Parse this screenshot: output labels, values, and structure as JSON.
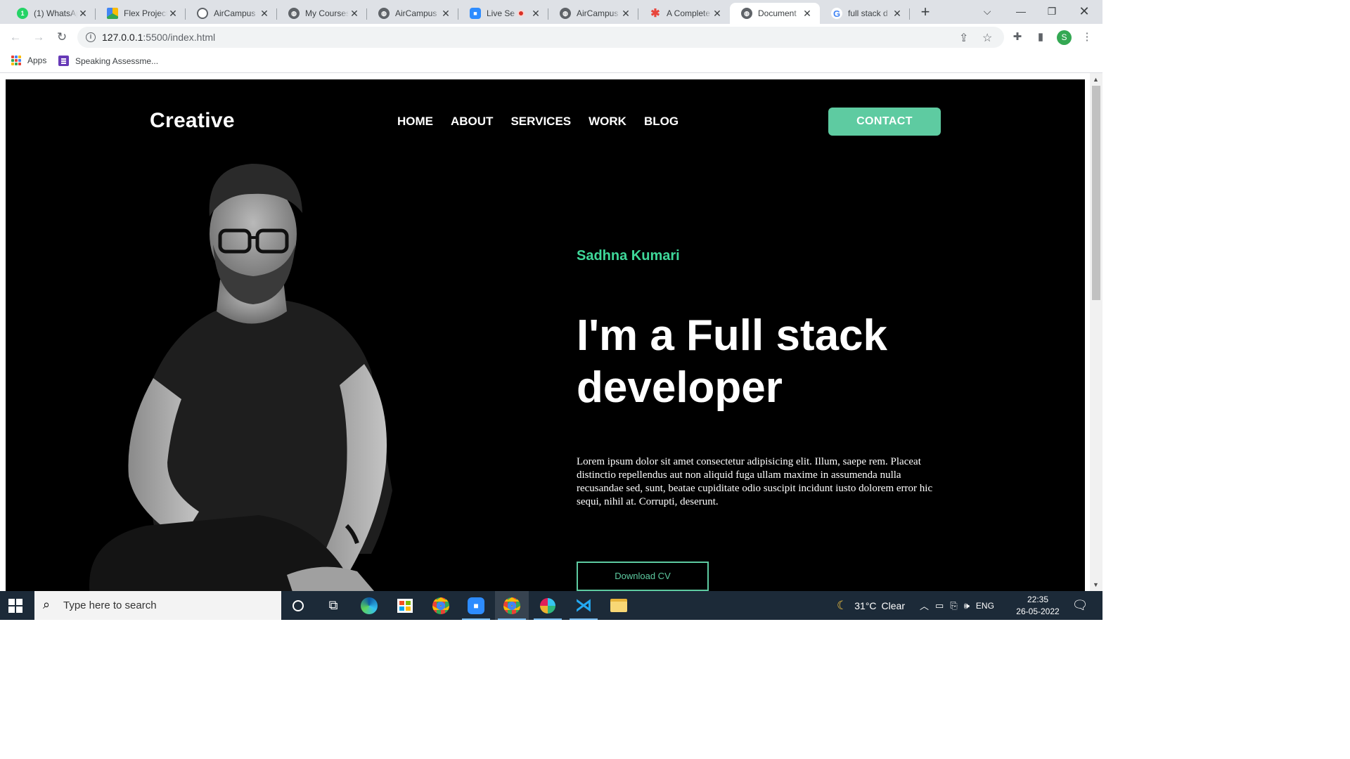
{
  "browser": {
    "tabs": [
      {
        "title": "(1) WhatsApp",
        "icon": "whatsapp-icon",
        "color": "#25d366",
        "badge": "1"
      },
      {
        "title": "Flex Project",
        "icon": "google-drive-icon",
        "color": "#fbbc04"
      },
      {
        "title": "AirCampus",
        "icon": "aircampus-icon",
        "color": "#5f6368"
      },
      {
        "title": "My Courses",
        "icon": "globe-icon",
        "color": "#5f6368"
      },
      {
        "title": "AirCampus",
        "icon": "globe-icon",
        "color": "#5f6368"
      },
      {
        "title": "Live Se",
        "icon": "zoom-icon",
        "color": "#2d8cff"
      },
      {
        "title": "AirCampus",
        "icon": "globe-icon",
        "color": "#5f6368"
      },
      {
        "title": "A Complete",
        "icon": "asterisk-icon",
        "color": "#e8453c"
      },
      {
        "title": "Document",
        "icon": "globe-icon",
        "color": "#5f6368",
        "active": true
      },
      {
        "title": "full stack d",
        "icon": "google-icon",
        "color": "#4285f4"
      }
    ],
    "url_host": "127.0.0.1",
    "url_path": ":5500/index.html",
    "profile_initial": "S",
    "bookmarks": [
      {
        "label": "Apps",
        "icon": "apps-grid-icon"
      },
      {
        "label": "Speaking Assessme...",
        "icon": "google-forms-icon"
      }
    ]
  },
  "site": {
    "logo": "Creative",
    "nav": [
      "HOME",
      "ABOUT",
      "SERVICES",
      "WORK",
      "BLOG"
    ],
    "contact_label": "CONTACT",
    "name": "Sadhna Kumari",
    "headline": "I'm a Full stack developer",
    "description": "Lorem ipsum dolor sit amet consectetur adipisicing elit. Illum, saepe rem. Placeat distinctio repellendus aut non aliquid fuga ullam maxime in assumenda nulla recusandae sed, sunt, beatae cupiditate odio suscipit incidunt iusto dolorem error hic sequi, nihil at. Corrupti, deserunt.",
    "cv_label": "Download CV",
    "colors": {
      "accent": "#5ecba1",
      "name": "#3fd89a",
      "background": "#000000"
    }
  },
  "taskbar": {
    "search_placeholder": "Type here to search",
    "apps": [
      "cortana-icon",
      "task-view-icon",
      "edge-icon",
      "store-icon",
      "chrome-icon",
      "zoom-icon",
      "chrome-icon",
      "slack-icon",
      "vscode-icon",
      "file-explorer-icon"
    ],
    "weather_temp": "31°C",
    "weather_text": "Clear",
    "language": "ENG",
    "time": "22:35",
    "date": "26-05-2022"
  }
}
